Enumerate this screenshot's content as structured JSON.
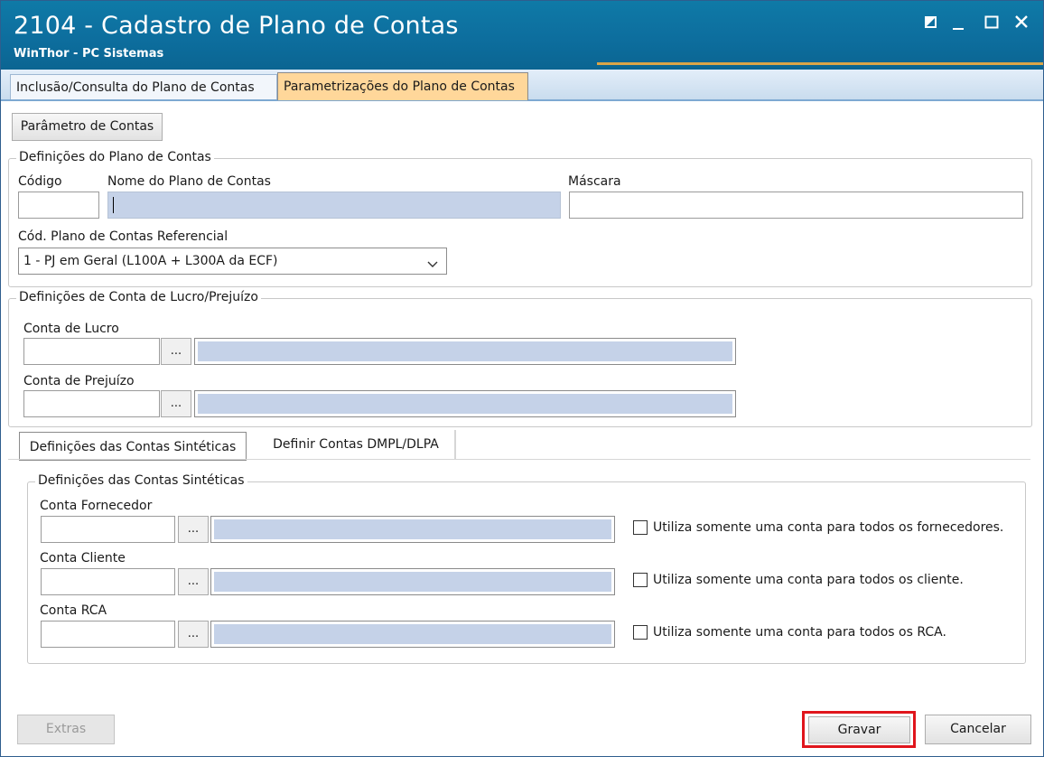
{
  "window": {
    "title": "2104 - Cadastro de Plano de Contas",
    "subtitle": "WinThor - PC Sistemas",
    "accent_color": "#0d6e9e"
  },
  "tabs": [
    {
      "label": "Inclusão/Consulta do Plano de Contas",
      "active": false
    },
    {
      "label": "Parametrizações do Plano de Contas",
      "active": true
    }
  ],
  "toolbar": {
    "parametro_label": "Parâmetro de Contas"
  },
  "definicoes_plano": {
    "title": "Definições do Plano de Contas",
    "codigo_label": "Código",
    "nome_label": "Nome do Plano de Contas",
    "mascara_label": "Máscara",
    "codigo_value": "",
    "nome_value": "",
    "mascara_value": "",
    "referencial_label": "Cód. Plano de Contas Referencial",
    "referencial_value": "1 - PJ em Geral (L100A + L300A da ECF)"
  },
  "lucro_prejuizo": {
    "title": "Definições de Conta de Lucro/Prejuízo",
    "lucro_label": "Conta de Lucro",
    "prejuizo_label": "Conta de Prejuízo",
    "lookup_label": "..."
  },
  "subtabs": [
    {
      "label": "Definições das Contas Sintéticas",
      "active": true
    },
    {
      "label": "Definir Contas DMPL/DLPA",
      "active": false
    }
  ],
  "sinteticas": {
    "title": "Definições das Contas Sintéticas",
    "rows": [
      {
        "label": "Conta Fornecedor",
        "checkbox_label": "Utiliza somente uma conta para todos os fornecedores.",
        "checked": false
      },
      {
        "label": "Conta Cliente",
        "checkbox_label": "Utiliza somente uma conta para todos os cliente.",
        "checked": false
      },
      {
        "label": "Conta RCA",
        "checkbox_label": "Utiliza somente uma conta para todos os RCA.",
        "checked": false
      }
    ]
  },
  "footer": {
    "extras_label": "Extras",
    "gravar_label": "Gravar",
    "cancelar_label": "Cancelar",
    "highlight_color": "#e0151c"
  }
}
